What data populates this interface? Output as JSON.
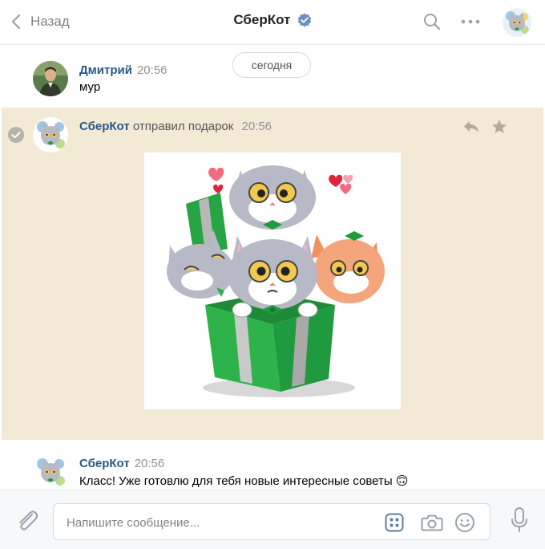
{
  "header": {
    "back_label": "Назад",
    "title": "СберКот"
  },
  "date_divider": "сегодня",
  "messages": [
    {
      "author": "Дмитрий",
      "time": "20:56",
      "text": "мур"
    },
    {
      "author": "СберКот",
      "action": "отправил подарок",
      "time": "20:56"
    },
    {
      "author": "СберКот",
      "time": "20:56",
      "text": "Класс! Уже готовлю для тебя новые интересные советы 🙃"
    }
  ],
  "composer": {
    "placeholder": "Напишите сообщение..."
  },
  "colors": {
    "link": "#2a5885",
    "gift_bg": "#f3ead6",
    "verified": "#6f8fbf",
    "gift_box": "#2eb34a"
  },
  "icons": [
    "back-icon",
    "verified-icon",
    "search-icon",
    "more-icon",
    "reply-icon",
    "star-icon",
    "attach-icon",
    "apps-icon",
    "camera-icon",
    "smile-icon",
    "mic-icon"
  ]
}
